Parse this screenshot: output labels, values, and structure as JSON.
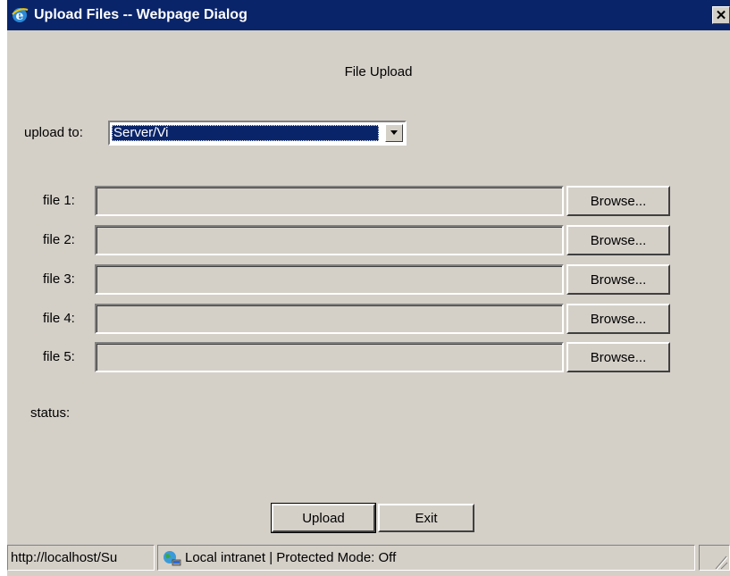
{
  "window": {
    "title": "Upload Files -- Webpage Dialog",
    "close_label": "✕"
  },
  "heading": "File Upload",
  "upload_to": {
    "label": "upload to:",
    "selected_value": "Server/Vi"
  },
  "files": [
    {
      "label": "file 1:",
      "value": "",
      "browse_label": "Browse..."
    },
    {
      "label": "file 2:",
      "value": "",
      "browse_label": "Browse..."
    },
    {
      "label": "file 3:",
      "value": "",
      "browse_label": "Browse..."
    },
    {
      "label": "file 4:",
      "value": "",
      "browse_label": "Browse..."
    },
    {
      "label": "file 5:",
      "value": "",
      "browse_label": "Browse..."
    }
  ],
  "status": {
    "label": "status:"
  },
  "buttons": {
    "upload_label": "Upload",
    "exit_label": "Exit"
  },
  "statusbar": {
    "url": "http://localhost/Su",
    "zone_text": "Local intranet | Protected Mode: Off"
  },
  "colors": {
    "titlebar": "#0a246a",
    "dialog_bg": "#d4d0c8",
    "selection": "#0a246a"
  }
}
